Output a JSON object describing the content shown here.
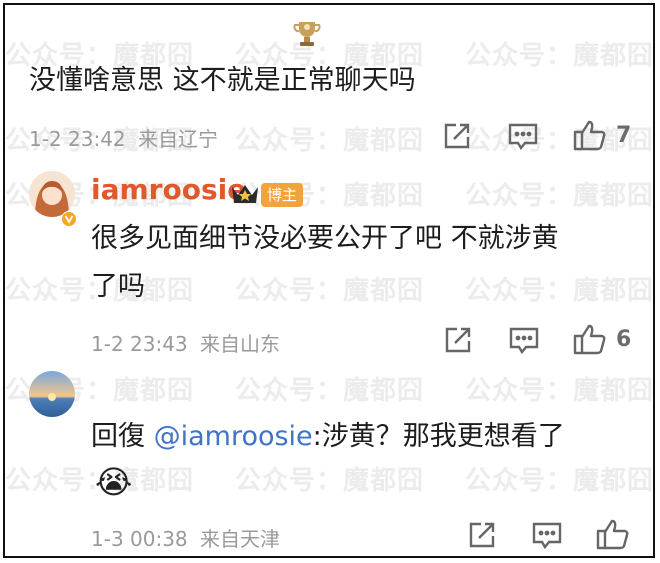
{
  "watermark": "公众号：魔都囧",
  "comment1": {
    "text": "没懂啥意思 这不就是正常聊天吗",
    "date": "1-2 23:42",
    "location": "来自辽宁",
    "likes": "7"
  },
  "comment2": {
    "username": "iamroosie",
    "badge": "博主",
    "text_line1": "很多见面细节没必要公开了吧 不就涉黄",
    "text_line2": "了吗",
    "date": "1-2 23:43",
    "location": "来自山东",
    "likes": "6"
  },
  "comment3": {
    "reply_prefix": "回復",
    "reply_target": "@iamroosie",
    "reply_text": ":涉黄？那我更想看了",
    "emoji": "😭",
    "date": "1-3 00:38",
    "location": "来自天津"
  },
  "colors": {
    "username": "#e0592a",
    "mention": "#3f74c8",
    "meta": "#9a9a9a",
    "badge": "#f3a33b"
  }
}
